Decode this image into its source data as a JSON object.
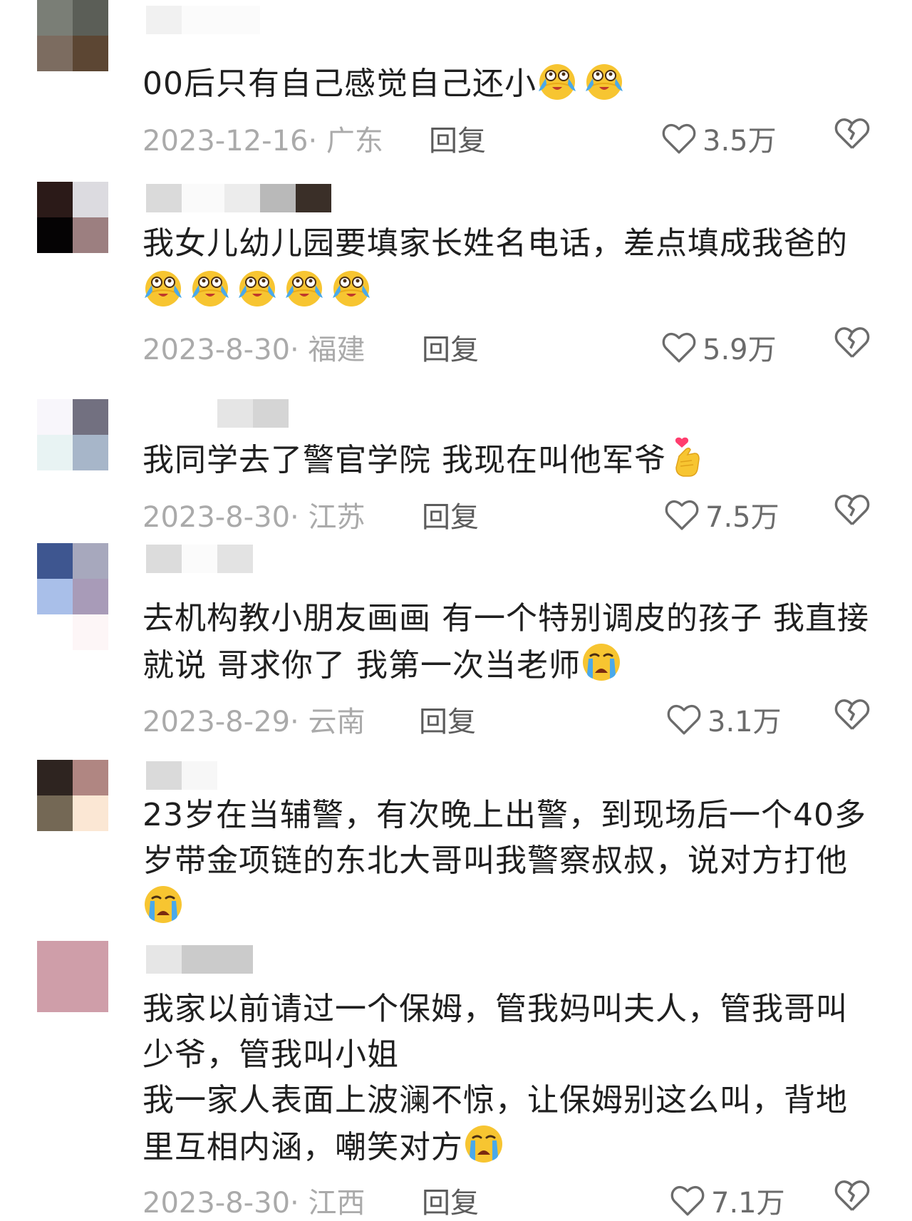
{
  "comments": [
    {
      "text": "00后只有自己感觉自己还小",
      "emojis_after": 2,
      "emoji_type": "crying-tears-emoji",
      "date": "2023-12-16",
      "location": "广东",
      "reply_label": "回复",
      "likes": "3.5万"
    },
    {
      "text": "我女儿幼儿园要填家长姓名电话，差点填成我爸的",
      "emojis_after": 5,
      "emoji_type": "crying-tears-emoji",
      "date": "2023-8-30",
      "location": "福建",
      "reply_label": "回复",
      "likes": "5.9万"
    },
    {
      "text": "我同学去了警官学院 我现在叫他军爷",
      "emojis_after": 1,
      "emoji_type": "finger-heart-emoji",
      "date": "2023-8-30",
      "location": "江苏",
      "reply_label": "回复",
      "likes": "7.5万"
    },
    {
      "text": "去机构教小朋友画画 有一个特别调皮的孩子 我直接就说 哥求你了 我第一次当老师",
      "emojis_after": 1,
      "emoji_type": "loudly-crying-emoji",
      "date": "2023-8-29",
      "location": "云南",
      "reply_label": "回复",
      "likes": "3.1万"
    },
    {
      "text": "23岁在当辅警，有次晚上出警，到现场后一个40多岁带金项链的东北大哥叫我警察叔叔，说对方打他",
      "emojis_after": 1,
      "emoji_type": "loudly-crying-emoji"
    },
    {
      "text": "我家以前请过一个保姆，管我妈叫夫人，管我哥叫少爷，管我叫小姐\n我一家人表面上波澜不惊，让保姆别这么叫，背地里互相内涵，嘲笑对方",
      "emojis_after": 1,
      "emoji_type": "loudly-crying-emoji",
      "date": "2023-8-30",
      "location": "江西",
      "reply_label": "回复",
      "likes": "7.1万"
    }
  ],
  "colors": {
    "text": "#1f1f1f",
    "meta": "#aaaaaa",
    "reply": "#5c5c5c",
    "emoji_yellow": "#f7c531",
    "tear_blue": "#4aa9ea"
  }
}
